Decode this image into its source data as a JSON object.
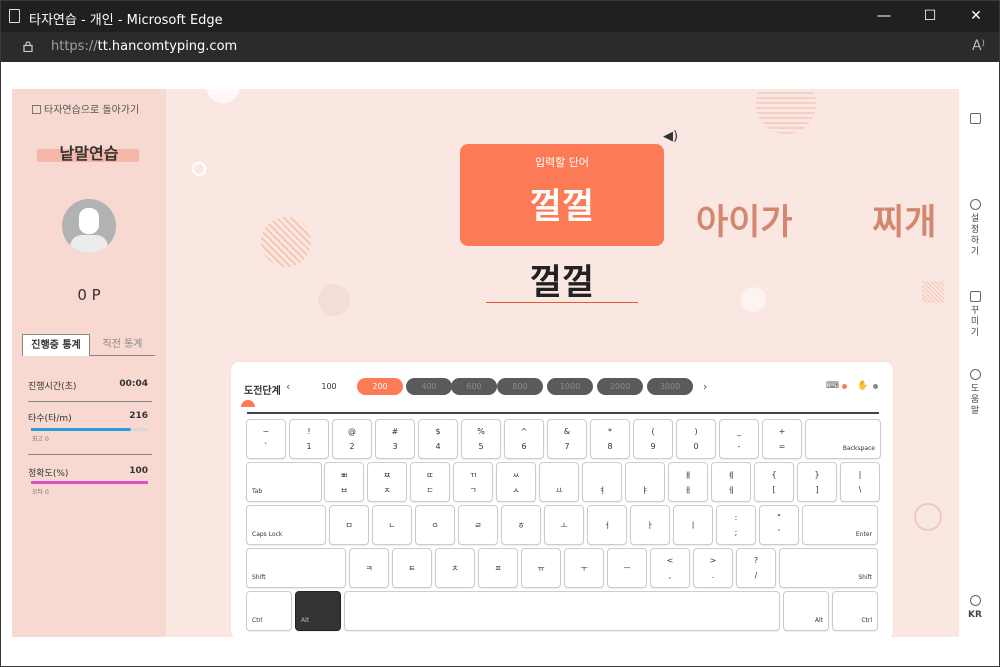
{
  "window": {
    "title": "타자연습 - 개인 - Microsoft Edge",
    "minimize": "—",
    "maximize": "☐",
    "close": "✕"
  },
  "address": {
    "prefix": "https://",
    "host": "tt.hancomtyping.com",
    "read_aloud": "A⁾"
  },
  "sidebar": {
    "back": "타자연습으로 돌아가기",
    "mode": "낱말연습",
    "points": "0 P",
    "tabs": {
      "current": "진행중 통계",
      "previous": "직전 통계"
    },
    "stats": {
      "time_label": "진행시간(초)",
      "time_value": "00:04",
      "speed_label": "타수(타/m)",
      "speed_value": "216",
      "speed_sub": "최고 0",
      "speed_fill": 0.85,
      "speed_color": "#2a9bd8",
      "accuracy_label": "정확도(%)",
      "accuracy_value": "100",
      "accuracy_sub": "오타 0",
      "accuracy_fill": 1.0,
      "accuracy_color": "#e24fc4"
    }
  },
  "main": {
    "target_label": "입력할 단어",
    "target_word": "껄껄",
    "next_words": [
      "아이가",
      "찌개"
    ],
    "typed": "껄껄",
    "speaker_icon": "speaker-icon",
    "accent": "#fd7a57"
  },
  "panel": {
    "level_label": "도전단계",
    "prev": "‹",
    "next": "›",
    "levels": [
      {
        "label": "100",
        "state": "white"
      },
      {
        "label": "200",
        "state": "active"
      },
      {
        "label": "400",
        "state": "locked"
      },
      {
        "label": "600",
        "state": "locked"
      },
      {
        "label": "800",
        "state": "locked"
      },
      {
        "label": "1000",
        "state": "locked"
      },
      {
        "label": "2000",
        "state": "locked"
      },
      {
        "label": "3000",
        "state": "locked"
      }
    ]
  },
  "keyboard": {
    "row1": [
      [
        "~",
        "`"
      ],
      [
        "!",
        "1"
      ],
      [
        "@",
        "2"
      ],
      [
        "#",
        "3"
      ],
      [
        "$",
        "4"
      ],
      [
        "%",
        "5"
      ],
      [
        "^",
        "6"
      ],
      [
        "&",
        "7"
      ],
      [
        "*",
        "8"
      ],
      [
        "(",
        "9"
      ],
      [
        ")",
        "0"
      ],
      [
        "_",
        "-"
      ],
      [
        "+",
        "="
      ]
    ],
    "backspace": "Backspace",
    "tab": "Tab",
    "row2": [
      [
        "ㅃ",
        "ㅂ"
      ],
      [
        "ㅉ",
        "ㅈ"
      ],
      [
        "ㄸ",
        "ㄷ"
      ],
      [
        "ㄲ",
        "ㄱ"
      ],
      [
        "ㅆ",
        "ㅅ"
      ],
      [
        "",
        "ㅛ"
      ],
      [
        "",
        "ㅕ"
      ],
      [
        "",
        "ㅑ"
      ],
      [
        "ㅒ",
        "ㅐ"
      ],
      [
        "ㅖ",
        "ㅔ"
      ],
      [
        "{",
        "["
      ],
      [
        "}",
        "]"
      ],
      [
        "|",
        "\\"
      ]
    ],
    "caps": "Caps Lock",
    "row3": [
      "ㅁ",
      "ㄴ",
      "ㅇ",
      "ㄹ",
      "ㅎ",
      "ㅗ",
      "ㅓ",
      "ㅏ",
      "ㅣ",
      [
        ":",
        ";"
      ],
      [
        "\"",
        "'"
      ]
    ],
    "enter": "Enter",
    "shift_l": "Shift",
    "row4": [
      "ㅋ",
      "ㅌ",
      "ㅊ",
      "ㅍ",
      "ㅠ",
      "ㅜ",
      "ㅡ",
      [
        "<",
        ","
      ],
      [
        ">",
        "."
      ],
      [
        "?",
        "/"
      ]
    ],
    "shift_r": "Shift",
    "ctrl_l": "Ctrl",
    "alt_l": "Alt",
    "alt_r": "Alt",
    "ctrl_r": "Ctrl"
  },
  "rail": {
    "settings": "설정하기",
    "decorate": "꾸미기",
    "help": "도움말",
    "lang": "KR"
  }
}
